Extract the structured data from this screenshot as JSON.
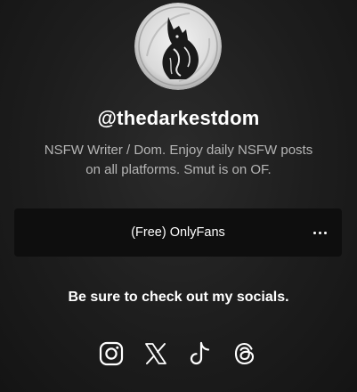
{
  "profile": {
    "handle": "@thedarkestdom",
    "bio": "NSFW Writer / Dom. Enjoy daily NSFW posts on all platforms. Smut is on OF."
  },
  "links": [
    {
      "label": "(Free) OnlyFans",
      "menu_icon": "more-dots-icon"
    }
  ],
  "socials": {
    "heading": "Be sure to check out my socials.",
    "icons": [
      "instagram-icon",
      "x-icon",
      "tiktok-icon",
      "threads-icon"
    ]
  },
  "colors": {
    "background": "#1d1d1d",
    "card": "#0e0e0e",
    "text": "#ffffff",
    "muted_text": "#b5b5b5"
  }
}
